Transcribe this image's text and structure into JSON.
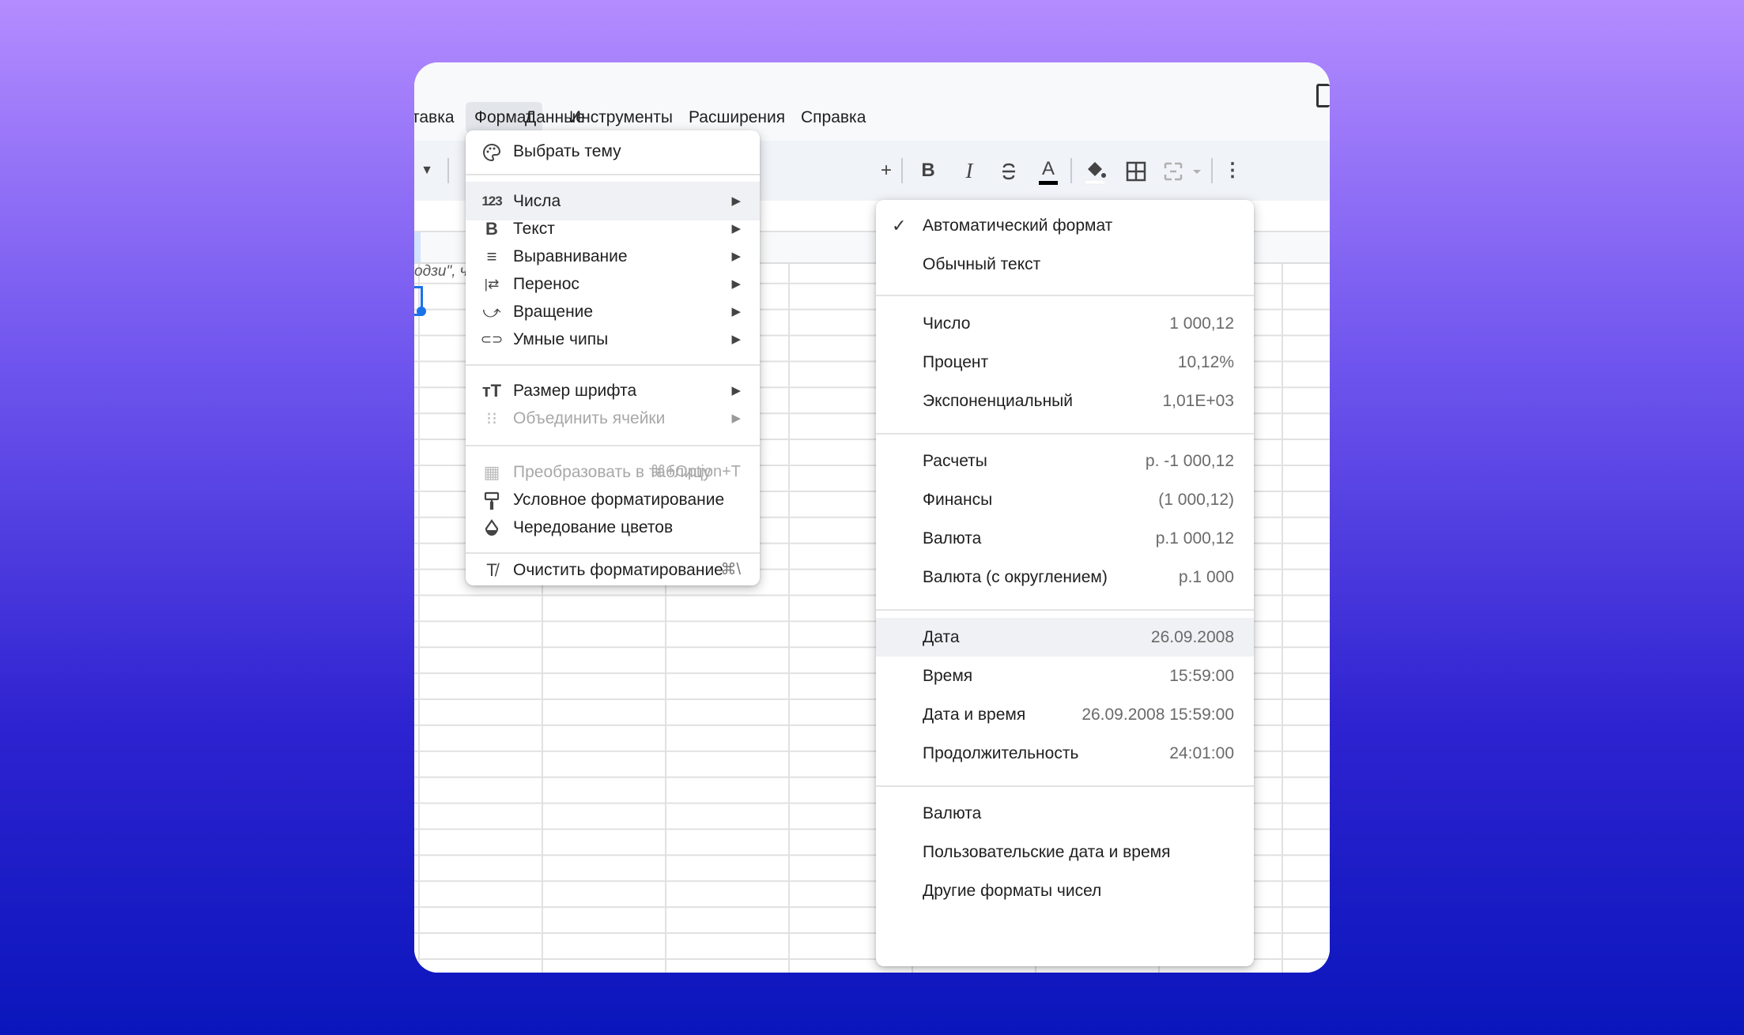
{
  "menubar": {
    "items": [
      "тавка",
      "Формат",
      "Данные",
      "Инструменты",
      "Расширения",
      "Справка"
    ]
  },
  "toolbar": {
    "plus": "+",
    "bold": "B",
    "italic": "I",
    "text_color": "A",
    "more": "⋮"
  },
  "sheet": {
    "cell_text": "одзи\", ч"
  },
  "format_menu": {
    "items": [
      {
        "icon": "palette-icon",
        "label": "Выбрать тему"
      },
      {
        "icon": "numbers-icon",
        "glyph": "123",
        "label": "Числа",
        "submenu": true,
        "highlighted": true
      },
      {
        "icon": "bold-icon",
        "glyph": "B",
        "label": "Текст",
        "submenu": true
      },
      {
        "icon": "align-icon",
        "glyph": "≡",
        "label": "Выравнивание",
        "submenu": true
      },
      {
        "icon": "wrap-icon",
        "glyph": "|⇄",
        "label": "Перенос",
        "submenu": true
      },
      {
        "icon": "rotate-icon",
        "glyph": "⤻",
        "label": "Вращение",
        "submenu": true
      },
      {
        "icon": "smart-chip-icon",
        "glyph": "⊂⊃",
        "label": "Умные чипы",
        "submenu": true
      },
      {
        "icon": "font-size-icon",
        "glyph": "тT",
        "label": "Размер шрифта",
        "submenu": true
      },
      {
        "icon": "merge-icon",
        "glyph": "⁝⁝",
        "label": "Объединить ячейки",
        "submenu": true,
        "disabled": true
      },
      {
        "icon": "table-icon",
        "glyph": "▦",
        "label": "Преобразовать в таблицу",
        "shortcut": "⌘+Option+T",
        "disabled": true
      },
      {
        "icon": "paint-format-icon",
        "glyph": "🖌",
        "label": "Условное форматирование"
      },
      {
        "icon": "color-drop-icon",
        "glyph": "◒",
        "label": "Чередование цветов"
      },
      {
        "icon": "clear-format-icon",
        "glyph": "T̸",
        "label": "Очистить форматирование",
        "shortcut": "⌘\\"
      }
    ]
  },
  "numbers_submenu": {
    "check": "✓",
    "items": [
      {
        "label": "Автоматический формат",
        "example": "",
        "checked": true
      },
      {
        "label": "Обычный текст",
        "example": ""
      },
      {
        "label": "Число",
        "example": "1 000,12"
      },
      {
        "label": "Процент",
        "example": "10,12%"
      },
      {
        "label": "Экспоненциальный",
        "example": "1,01E+03"
      },
      {
        "label": "Расчеты",
        "example": "р. -1 000,12"
      },
      {
        "label": "Финансы",
        "example": "(1 000,12)"
      },
      {
        "label": "Валюта",
        "example": "р.1 000,12"
      },
      {
        "label": "Валюта (с округлением)",
        "example": "р.1 000"
      },
      {
        "label": "Дата",
        "example": "26.09.2008",
        "highlighted": true
      },
      {
        "label": "Время",
        "example": "15:59:00"
      },
      {
        "label": "Дата и время",
        "example": "26.09.2008 15:59:00"
      },
      {
        "label": "Продолжительность",
        "example": "24:01:00"
      },
      {
        "label": "Валюта",
        "example": ""
      },
      {
        "label": "Пользовательские дата и время",
        "example": ""
      },
      {
        "label": "Другие форматы чисел",
        "example": ""
      }
    ]
  },
  "colors": {
    "accent": "#1a73e8",
    "highlight": "#eff1f4"
  }
}
